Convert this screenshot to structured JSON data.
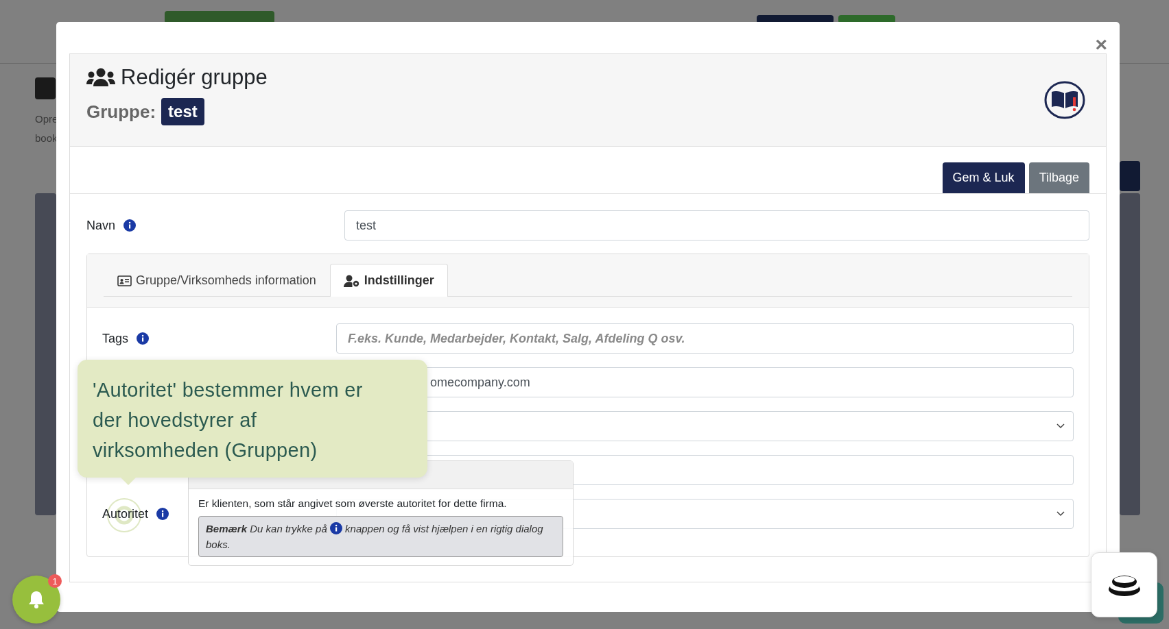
{
  "background_texts": [
    "Opre",
    "book"
  ],
  "modal": {
    "title": "Redigér gruppe",
    "group_label": "Gruppe:",
    "group_name": "test",
    "close": "×",
    "buttons": [
      {
        "label": "Gem & Luk",
        "kind": "primary"
      },
      {
        "label": "Tilbage",
        "kind": "secondary"
      }
    ]
  },
  "name_field": {
    "label": "Navn",
    "value": "test"
  },
  "tabs": [
    {
      "label": "Gruppe/Virksomheds information",
      "selected": false
    },
    {
      "label": "Indstillinger",
      "selected": true
    }
  ],
  "fields": [
    {
      "label": "Tags",
      "kind": "text",
      "placeholder": "F.eks. Kunde, Medarbejder, Kontakt, Salg, Afdeling Q osv."
    },
    {
      "kind": "text",
      "value": "omecompany.com"
    },
    {
      "kind": "select"
    },
    {
      "kind": "text"
    },
    {
      "label": "Autoritet",
      "kind": "select"
    }
  ],
  "tooltip": {
    "text": "'Autoritet' bestemmer hvem er der hovedstyrer af virksomheden (Gruppen)"
  },
  "help_popover": {
    "text": "Er klienten, som står angivet som øverste autoritet for dette firma.",
    "note_parts": [
      "**Bemærk** Du kan trykke på",
      "knappen og få vist hjælpen i en rigtig dialog boks."
    ]
  },
  "notifications": {
    "count": "1"
  }
}
